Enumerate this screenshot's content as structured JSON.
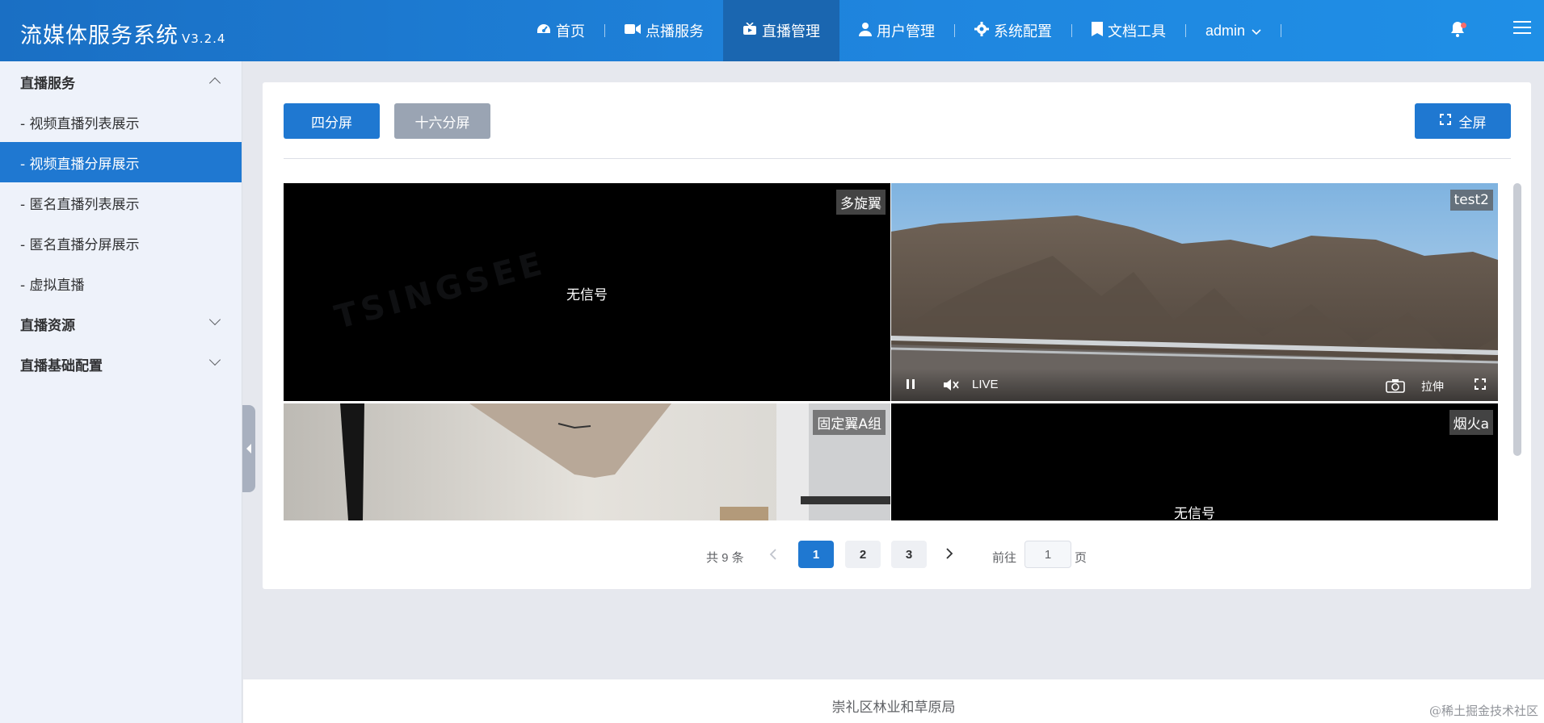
{
  "header": {
    "title": "流媒体服务系统",
    "version": "V3.2.4",
    "nav": [
      {
        "label": "首页",
        "icon": "dashboard-icon"
      },
      {
        "label": "点播服务",
        "icon": "video-camera-icon"
      },
      {
        "label": "直播管理",
        "icon": "live-tv-icon",
        "active": true
      },
      {
        "label": "用户管理",
        "icon": "user-icon"
      },
      {
        "label": "系统配置",
        "icon": "gear-icon"
      },
      {
        "label": "文档工具",
        "icon": "bookmark-icon"
      }
    ],
    "user": "admin",
    "colors": {
      "header_start": "#1a6fc4",
      "header_end": "#1f8fe6",
      "active_nav": "#1a66b0"
    }
  },
  "sidebar": {
    "groups": [
      {
        "label": "直播服务",
        "expanded": true,
        "items": [
          {
            "label": "- 视频直播列表展示"
          },
          {
            "label": "- 视频直播分屏展示",
            "active": true
          },
          {
            "label": "- 匿名直播列表展示"
          },
          {
            "label": "- 匿名直播分屏展示"
          },
          {
            "label": "- 虚拟直播"
          }
        ]
      },
      {
        "label": "直播资源",
        "expanded": false
      },
      {
        "label": "直播基础配置",
        "expanded": false
      }
    ],
    "active_color": "#1f78d1"
  },
  "toolbar": {
    "quad_label": "四分屏",
    "sixteen_label": "十六分屏",
    "fullscreen_label": "全屏"
  },
  "player_grid": {
    "cells": [
      {
        "name": "多旋翼",
        "status": "无信号"
      },
      {
        "name": "test2",
        "status": "LIVE"
      },
      {
        "name": "固定翼A组",
        "status": ""
      },
      {
        "name": "烟火a",
        "status": "无信号"
      }
    ],
    "controls": {
      "live_label": "LIVE",
      "stretch_label": "拉伸"
    }
  },
  "pagination": {
    "total_text": "共 9 条",
    "pages": [
      "1",
      "2",
      "3"
    ],
    "current_page": 1,
    "goto_label": "前往",
    "goto_value": "1",
    "page_suffix": "页"
  },
  "footer": {
    "text": "崇礼区林业和草原局",
    "credit": "@稀土掘金技术社区"
  }
}
